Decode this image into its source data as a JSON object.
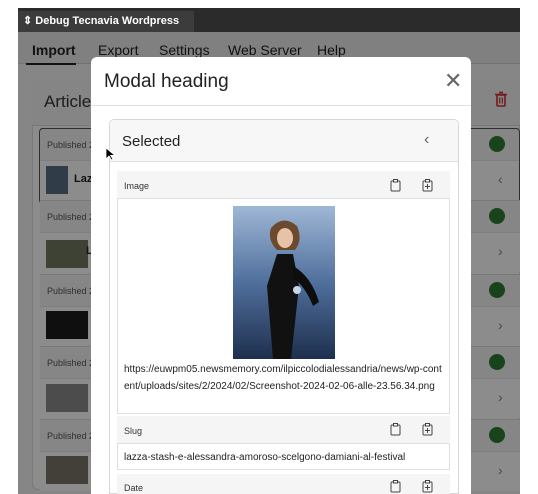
{
  "window": {
    "title": "Debug Tecnavia Wordpress Connector"
  },
  "menu": {
    "items": [
      "Import",
      "Export",
      "Settings",
      "Web Server",
      "Help"
    ],
    "active": "Import"
  },
  "articles": {
    "title": "Article",
    "rows": [
      {
        "published": "Published 2",
        "text": "Laz",
        "status_color": "#2e7d32"
      },
      {
        "published": "Published 2",
        "text": "L",
        "status_color": "#2e7d32"
      },
      {
        "published": "Published 2",
        "text": "",
        "status_color": "#2e7d32"
      },
      {
        "published": "Published 2",
        "text": "",
        "status_color": "#2e7d32"
      },
      {
        "published": "Published 2",
        "text": "",
        "status_color": "#2e7d32"
      }
    ]
  },
  "modal": {
    "heading": "Modal heading",
    "accordion": {
      "title": "Selected",
      "fields": {
        "image": {
          "label": "Image",
          "url": "https://euwpm05.newsmemory.com/ilpiccolodialessandria/news/wp-content/uploads/sites/2/2024/02/Screenshot-2024-02-06-alle-23.56.34.png"
        },
        "slug": {
          "label": "Slug",
          "value": "lazza-stash-e-alessandra-amoroso-scelgono-damiani-al-festival"
        },
        "date": {
          "label": "Date"
        }
      }
    }
  },
  "icons": [
    "trash-icon",
    "close-icon",
    "chevron-left-icon",
    "chevron-right-icon",
    "clipboard-icon",
    "clipboard-add-icon",
    "cursor-icon"
  ],
  "colors": {
    "accent": "#2e7d32",
    "titlebar": "#2b2b2b",
    "danger": "#d32f2f"
  }
}
